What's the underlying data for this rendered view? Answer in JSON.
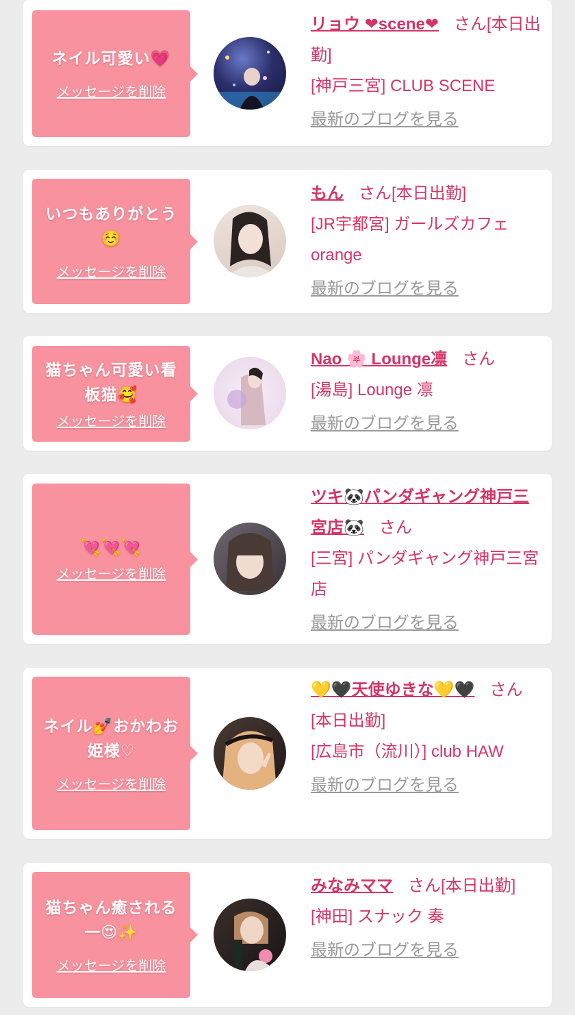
{
  "delete_label": "メッセージを削除",
  "blog_label": "最新のブログを見る",
  "cards": [
    {
      "message": "ネイル可愛い💗",
      "name": "リョウ ❤scene❤",
      "suffix": "さん[本日出勤]",
      "shop": "[神戸三宮] CLUB SCENE"
    },
    {
      "message": "いつもありがとう☺️",
      "name": "もん",
      "suffix": "さん[本日出勤]",
      "shop": "[JR宇都宮] ガールズカフェorange"
    },
    {
      "message": "猫ちゃん可愛い看板猫🥰",
      "name": "Nao 🌸 Lounge凛",
      "suffix": "さん",
      "shop": "[湯島] Lounge 凛"
    },
    {
      "message": "💘💘💘",
      "name": "ツキ🐼パンダギャング神戸三宮店🐼",
      "suffix": "さん",
      "shop": "[三宮] パンダギャング神戸三宮店"
    },
    {
      "message": "ネイル💅おかわお姫様♡",
      "name": "💛🖤天使ゆきな💛🖤",
      "suffix": "さん[本日出勤]",
      "shop": "[広島市（流川）] club HAW"
    },
    {
      "message": "猫ちゃん癒される一😍✨",
      "name": "みなみママ",
      "suffix": "さん[本日出勤]",
      "shop": "[神田] スナック 奏"
    }
  ],
  "colors": {
    "bubble": "#f7929e",
    "name": "#d43468",
    "blog_link": "#9a9a9a",
    "background": "#ececec"
  }
}
